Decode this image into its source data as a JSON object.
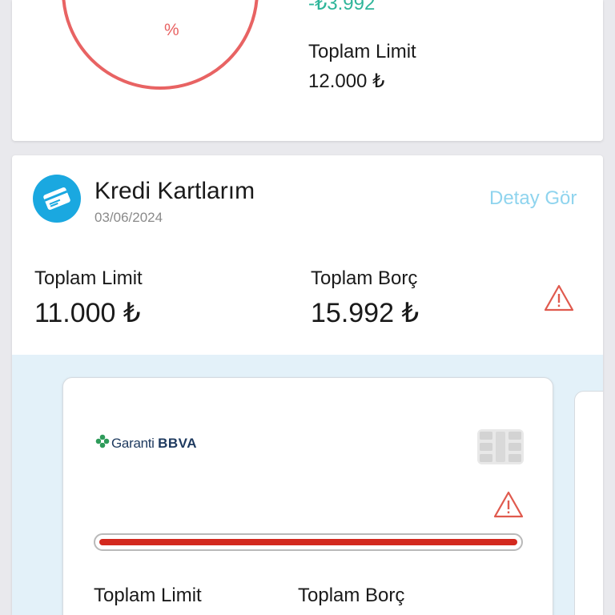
{
  "summary_card": {
    "percent_sign": "%",
    "available_amount": "-₺3.992",
    "total_limit_label": "Toplam Limit",
    "total_limit_value": "12.000 ₺"
  },
  "credit_cards": {
    "title": "Kredi Kartlarım",
    "date": "03/06/2024",
    "detail_link": "Detay Gör",
    "total_limit_label": "Toplam Limit",
    "total_limit_value": "11.000 ₺",
    "total_debt_label": "Toplam Borç",
    "total_debt_value": "15.992 ₺",
    "icons": {
      "card": "credit-card-icon",
      "warning": "warning-icon"
    },
    "colors": {
      "accent": "#1aa8e0",
      "warning": "#e05a4e",
      "debt_bar": "#d3291e",
      "link": "#8fd4ee"
    }
  },
  "bank_card": {
    "bank_name": "Garanti",
    "bank_name_bold": "BBVA",
    "usage_fraction": 1.0,
    "limit_label": "Toplam Limit",
    "debt_label": "Toplam Borç"
  }
}
